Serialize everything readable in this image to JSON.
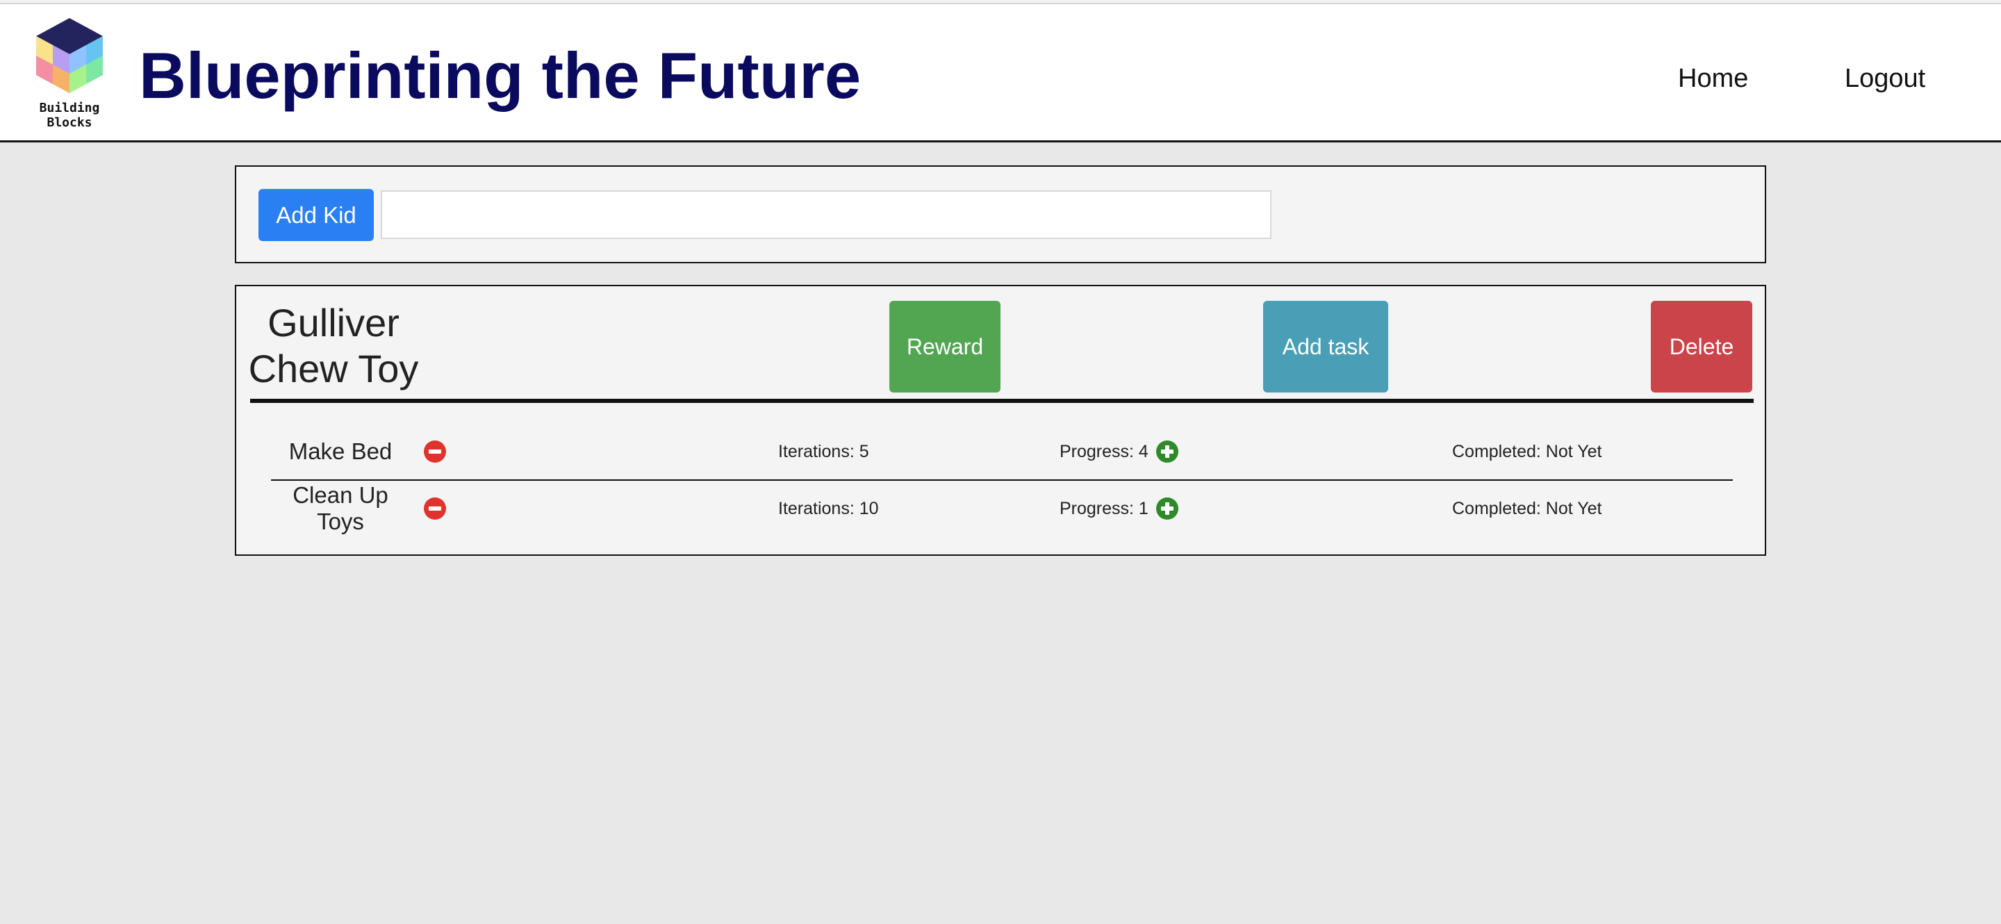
{
  "header": {
    "logo_text": "Building Blocks",
    "title": "Blueprinting the Future",
    "nav": {
      "home": "Home",
      "logout": "Logout"
    }
  },
  "add_kid": {
    "button_label": "Add Kid",
    "input_value": "",
    "input_placeholder": ""
  },
  "kids": [
    {
      "name_line1": "Gulliver",
      "name_line2": "Chew Toy",
      "buttons": {
        "reward": "Reward",
        "add_task": "Add task",
        "delete": "Delete"
      },
      "tasks": [
        {
          "name": "Make Bed",
          "iterations": "Iterations: 5",
          "progress": "Progress: 4",
          "completed": "Completed: Not Yet"
        },
        {
          "name": "Clean Up Toys",
          "iterations": "Iterations: 10",
          "progress": "Progress: 1",
          "completed": "Completed: Not Yet"
        }
      ]
    }
  ],
  "colors": {
    "title": "#0a0a5e",
    "add_kid_button": "#2a7ff2",
    "reward_button": "#52a652",
    "add_task_button": "#4a9fb6",
    "delete_button": "#cb444a",
    "remove_icon": "#e0332d",
    "increment_icon": "#2f8a2a"
  },
  "icons": {
    "logo": "cube-logo-icon",
    "remove_task": "minus-circle-icon",
    "increment_progress": "plus-circle-icon"
  }
}
